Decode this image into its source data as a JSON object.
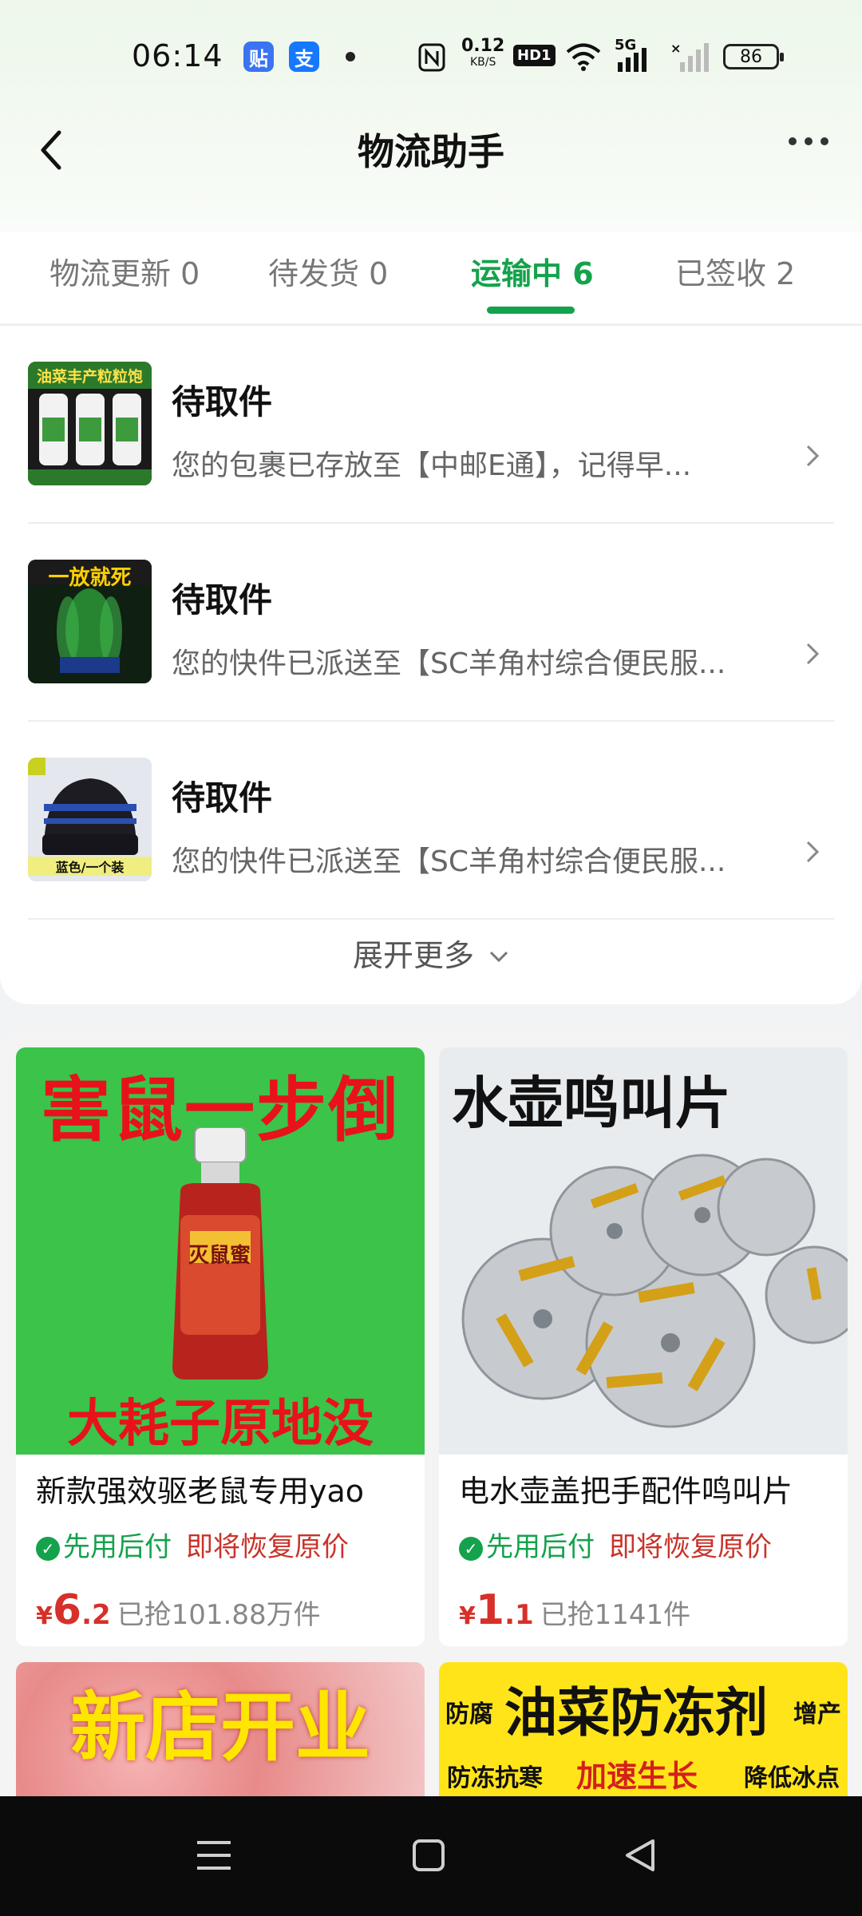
{
  "status_bar": {
    "time": "06:14",
    "apps": [
      {
        "name": "tieba-icon",
        "glyph": "贴",
        "color": "#3a74f2"
      },
      {
        "name": "alipay-icon",
        "glyph": "支",
        "color": "#1677ff"
      }
    ],
    "net_speed_value": "0.12",
    "net_speed_unit": "KB/S",
    "hd_label": "HD1",
    "network_label": "5G",
    "battery": "86"
  },
  "nav": {
    "title": "物流助手",
    "back_glyph": "‹",
    "more_glyph": "···"
  },
  "tabs": [
    {
      "label": "物流更新 0"
    },
    {
      "label": "待发货 0"
    },
    {
      "label": "运输中 6"
    },
    {
      "label": "已签收 2"
    }
  ],
  "active_tab": 2,
  "logistics": [
    {
      "title": "待取件",
      "desc": "您的包裹已存放至【中邮E通】，记得早...",
      "thumb_text": "油菜丰产粒粒饱"
    },
    {
      "title": "待取件",
      "desc": "您的快件已派送至【SC羊角村综合便民服...",
      "thumb_text": "一放就死"
    },
    {
      "title": "待取件",
      "desc": "您的快件已派送至【SC羊角村综合便民服...",
      "thumb_text": "蓝色/一个装"
    }
  ],
  "expand_label": "展开更多",
  "products": [
    {
      "img_headline": "害鼠一步倒",
      "img_footer": "大耗子原地没",
      "img_label": "灭鼠蜜",
      "title": "新款强效驱老鼠专用yao",
      "tag_green": "先用后付",
      "tag_red": "即将恢复原价",
      "price_symbol": "¥",
      "price_int": "6",
      "price_dec": ".2",
      "sold": "已抢101.88万件"
    },
    {
      "img_headline": "水壶鸣叫片",
      "title": "电水壶盖把手配件鸣叫片",
      "tag_green": "先用后付",
      "tag_red": "即将恢复原价",
      "price_symbol": "¥",
      "price_int": "1",
      "price_dec": ".1",
      "sold": "已抢1141件"
    },
    {
      "img_headline": "新店开业"
    },
    {
      "img_headline": "油菜防冻剂",
      "img_left": "防腐",
      "img_right": "增产",
      "img_sub1": "防冻抗寒",
      "img_sub2": "加速生长",
      "img_sub3": "降低冰点"
    }
  ],
  "colors": {
    "accent": "#14a24c",
    "price": "#d6302a",
    "promo": "#c9332a"
  }
}
